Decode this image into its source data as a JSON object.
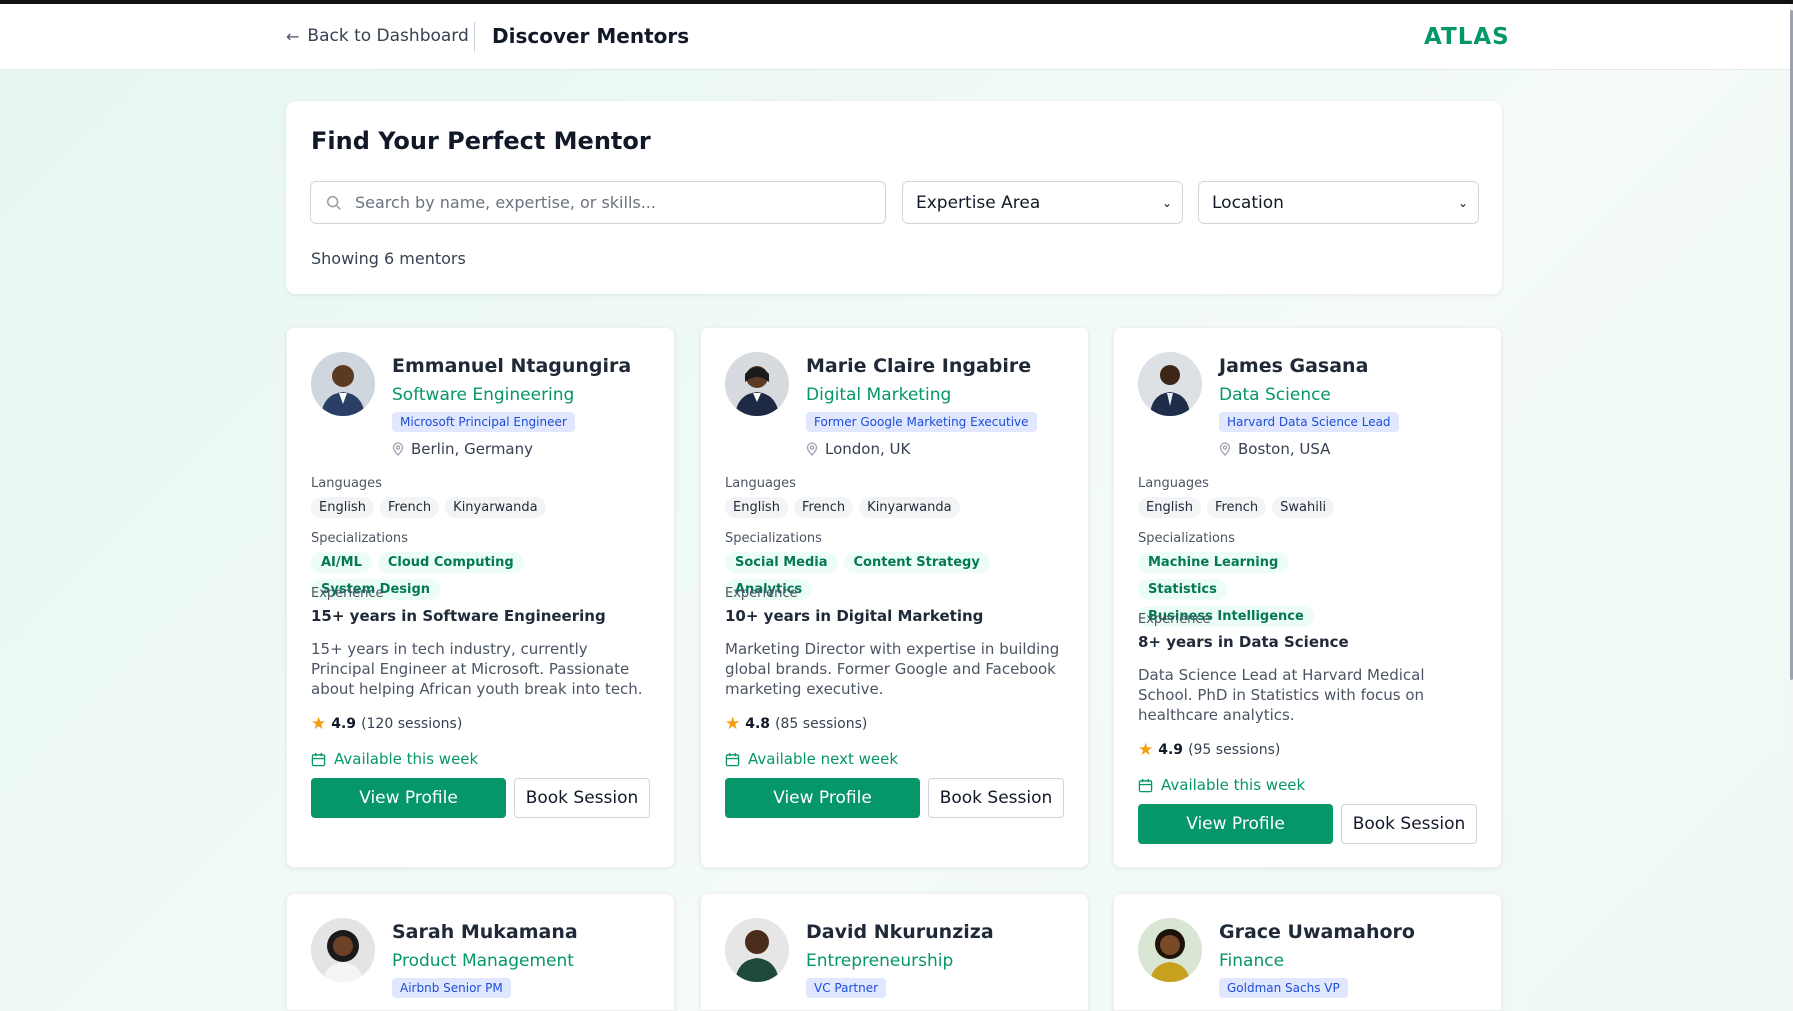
{
  "header": {
    "back_label": "Back to Dashboard",
    "title": "Discover Mentors",
    "logo": "ATLAS"
  },
  "search": {
    "heading": "Find Your Perfect Mentor",
    "placeholder": "Search by name, expertise, or skills...",
    "expertise_select": "Expertise Area",
    "location_select": "Location",
    "result_count": "Showing 6 mentors"
  },
  "labels": {
    "languages": "Languages",
    "specializations": "Specializations",
    "experience": "Experience",
    "view_profile": "View Profile",
    "book_session": "Book Session"
  },
  "mentors": [
    {
      "name": "Emmanuel Ntagungira",
      "field": "Software Engineering",
      "credential": "Microsoft Principal Engineer",
      "location": "Berlin, Germany",
      "languages": [
        "English",
        "French",
        "Kinyarwanda"
      ],
      "specializations": [
        "AI/ML",
        "Cloud Computing",
        "System Design"
      ],
      "experience": "15+ years in Software Engineering",
      "bio": "15+ years in tech industry, currently Principal Engineer at Microsoft. Passionate about helping African youth break into tech.",
      "rating": "4.9",
      "sessions": "(120 sessions)",
      "availability": "Available this week",
      "avatar_color": "#2b3f66"
    },
    {
      "name": "Marie Claire Ingabire",
      "field": "Digital Marketing",
      "credential": "Former Google Marketing Executive",
      "location": "London, UK",
      "languages": [
        "English",
        "French",
        "Kinyarwanda"
      ],
      "specializations": [
        "Social Media",
        "Content Strategy",
        "Analytics"
      ],
      "experience": "10+ years in Digital Marketing",
      "bio": "Marketing Director with expertise in building global brands. Former Google and Facebook marketing executive.",
      "rating": "4.8",
      "sessions": "(85 sessions)",
      "availability": "Available next week",
      "avatar_color": "#1e2a44"
    },
    {
      "name": "James Gasana",
      "field": "Data Science",
      "credential": "Harvard Data Science Lead",
      "location": "Boston, USA",
      "languages": [
        "English",
        "French",
        "Swahili"
      ],
      "specializations": [
        "Machine Learning",
        "Statistics",
        "Business Intelligence"
      ],
      "experience": "8+ years in Data Science",
      "bio": "Data Science Lead at Harvard Medical School. PhD in Statistics with focus on healthcare analytics.",
      "rating": "4.9",
      "sessions": "(95 sessions)",
      "availability": "Available this week",
      "avatar_color": "#1f2d4a"
    },
    {
      "name": "Sarah Mukamana",
      "field": "Product Management",
      "credential": "Airbnb Senior PM",
      "avatar_color": "#2a2a2a"
    },
    {
      "name": "David Nkurunziza",
      "field": "Entrepreneurship",
      "credential": "VC Partner",
      "avatar_color": "#1d4a3a"
    },
    {
      "name": "Grace Uwamahoro",
      "field": "Finance",
      "credential": "Goldman Sachs VP",
      "avatar_color": "#c8a020"
    }
  ]
}
